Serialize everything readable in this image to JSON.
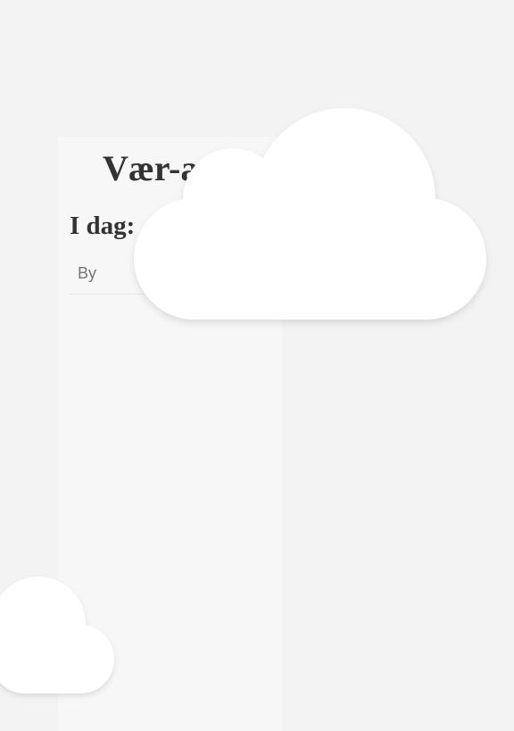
{
  "app": {
    "title": "Vær-app"
  },
  "today": {
    "heading": "I dag:"
  },
  "search": {
    "placeholder": "By",
    "value": ""
  },
  "decorations": {
    "cloud_icons": [
      "cloud-icon",
      "cloud-icon"
    ],
    "background_color": "#f3f3f3",
    "panel_color": "#f7f7f7",
    "cloud_color": "#ffffff",
    "text_color": "#333333"
  }
}
